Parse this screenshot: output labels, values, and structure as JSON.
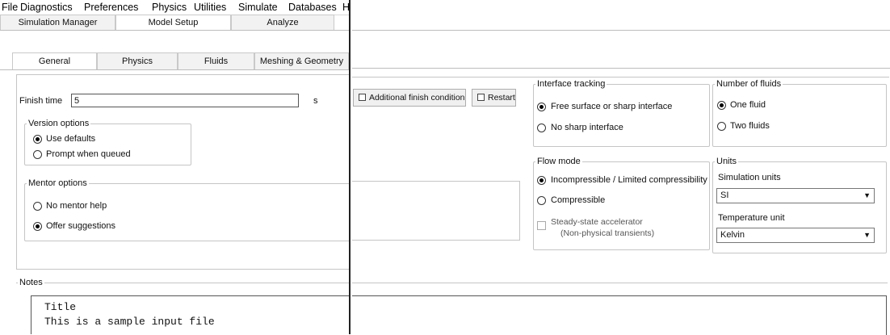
{
  "menubar": {
    "items": [
      "File",
      "Diagnostics",
      "Preferences",
      "Physics",
      "Utilities",
      "Simulate",
      "Databases",
      "H"
    ]
  },
  "main_tabs": [
    "Simulation Manager",
    "Model Setup",
    "Analyze"
  ],
  "sub_tabs": [
    "General",
    "Physics",
    "Fluids",
    "Meshing & Geometry"
  ],
  "finish": {
    "label": "Finish time",
    "value": "5",
    "unit": "s"
  },
  "version_options": {
    "title": "Version options",
    "options": [
      "Use defaults",
      "Prompt when queued"
    ],
    "selected": "Use defaults"
  },
  "mentor_options": {
    "title": "Mentor options",
    "options": [
      "No mentor help",
      "Offer suggestions"
    ],
    "selected": "Offer suggestions"
  },
  "additional_finish_label": "Additional finish condition",
  "restart_label": "Restart",
  "interface_tracking": {
    "title": "Interface tracking",
    "options": [
      "Free surface or sharp interface",
      "No sharp interface"
    ],
    "selected": "Free surface or sharp interface"
  },
  "number_of_fluids": {
    "title": "Number of fluids",
    "options": [
      "One fluid",
      "Two fluids"
    ],
    "selected": "One fluid"
  },
  "flow_mode": {
    "title": "Flow mode",
    "options": [
      "Incompressible / Limited compressibility",
      "Compressible"
    ],
    "selected": "Incompressible / Limited compressibility",
    "steady_state_line1": "Steady-state accelerator",
    "steady_state_line2": "(Non-physical transients)"
  },
  "units": {
    "title": "Units",
    "simulation_units_label": "Simulation units",
    "simulation_units_value": "SI",
    "temperature_unit_label": "Temperature unit",
    "temperature_unit_value": "Kelvin"
  },
  "notes": {
    "title": "Notes",
    "line1": "Title",
    "line2": "This is a sample input file"
  }
}
